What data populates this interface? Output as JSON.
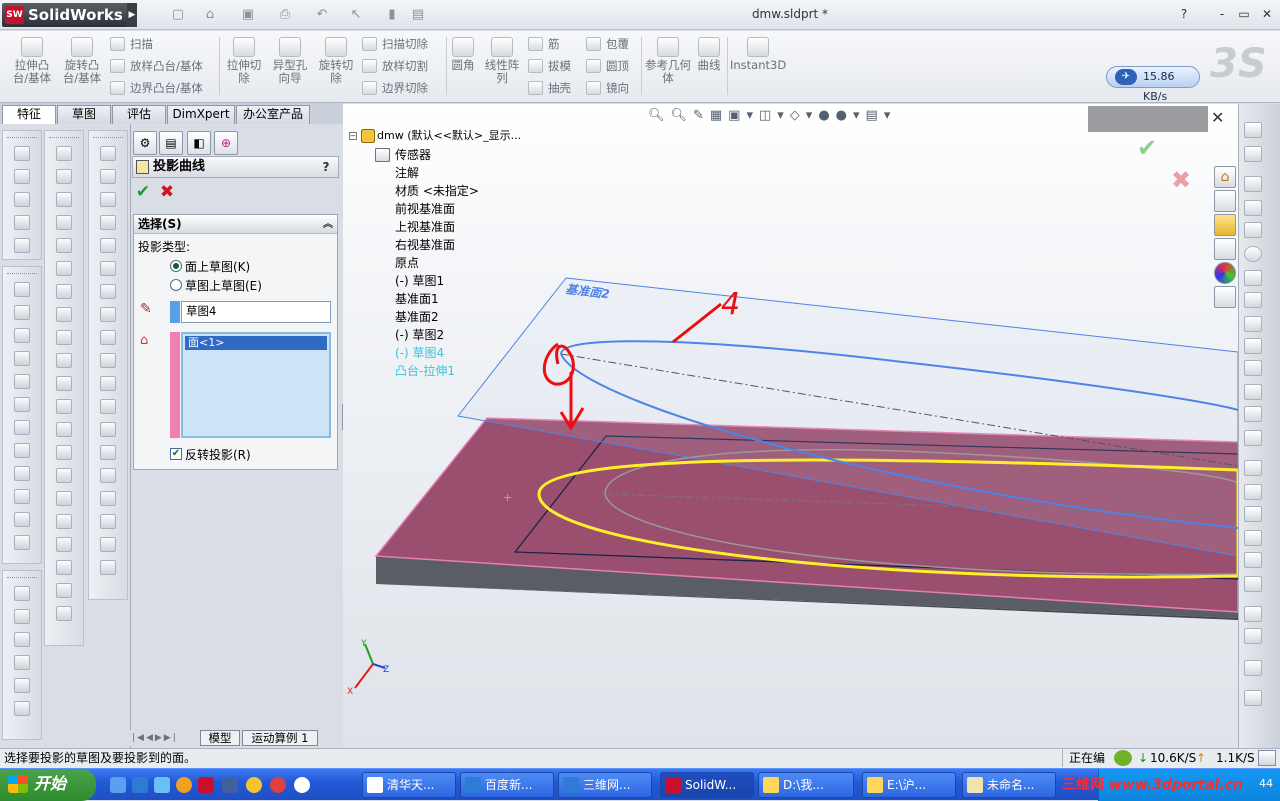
{
  "app": {
    "brand": "SolidWorks",
    "brand_icon_text": "SW",
    "document_title": "dmw.sldprt *",
    "window_controls": [
      "?",
      "-",
      "▭",
      "✕"
    ]
  },
  "command_manager": {
    "big_buttons": [
      "拉伸凸台/基体",
      "旋转凸台/基体",
      "拉伸切除",
      "异型孔向导",
      "旋转切除",
      "圆角",
      "线性阵列",
      "参考几何体",
      "曲线",
      "Instant3D"
    ],
    "sweep_group": [
      "扫描",
      "放样凸台/基体",
      "边界凸台/基体"
    ],
    "cut_group": [
      "扫描切除",
      "放样切割",
      "边界切除"
    ],
    "feature_group": [
      "筋",
      "拔模",
      "抽壳"
    ],
    "wrap_group": [
      "包覆",
      "圆顶",
      "镜向"
    ],
    "net_speed": "15.86 KB/s"
  },
  "tabs": [
    "特征",
    "草图",
    "评估",
    "DimXpert",
    "办公室产品"
  ],
  "property_manager": {
    "title": "投影曲线",
    "help": "?",
    "group_title": "选择(S)",
    "projection_type_label": "投影类型:",
    "option_sketch_on_face": "面上草图(K)",
    "option_sketch_on_sketch": "草图上草图(E)",
    "sketch_field": "草图4",
    "faces_list": [
      "面<1>"
    ],
    "reverse_label": "反转投影(R)",
    "reverse_checked": true
  },
  "bottom_tabs": [
    "模型",
    "运动算例 1"
  ],
  "feature_tree": {
    "root": "dmw   (默认<<默认>_显示...",
    "items": [
      {
        "label": "传感器",
        "highlight": false
      },
      {
        "label": "注解",
        "highlight": false
      },
      {
        "label": "材质 <未指定>",
        "highlight": false
      },
      {
        "label": "前视基准面",
        "highlight": false
      },
      {
        "label": "上视基准面",
        "highlight": false
      },
      {
        "label": "右视基准面",
        "highlight": false
      },
      {
        "label": "原点",
        "highlight": false
      },
      {
        "label": "(-) 草图1",
        "highlight": false
      },
      {
        "label": "基准面1",
        "highlight": false
      },
      {
        "label": "基准面2",
        "highlight": false
      },
      {
        "label": "(-) 草图2",
        "highlight": false
      },
      {
        "label": "(-) 草图4",
        "highlight": true
      },
      {
        "label": "凸台-拉伸1",
        "highlight": true
      }
    ]
  },
  "viewport": {
    "plane_label": "基准面2",
    "annotation_text": "4",
    "triad": {
      "x": "X",
      "y": "Y",
      "z": "Z"
    },
    "close": "✕"
  },
  "statusbar": {
    "message": "选择要投影的草图及要投影到的面。",
    "right_status": "正在编",
    "download": "10.6K/S",
    "upload": "1.1K/S"
  },
  "taskbar": {
    "start": "开始",
    "tasks": [
      "清华天...",
      "百度新...",
      "三维网...",
      "SolidW...",
      "D:\\我...",
      "E:\\沪...",
      "未命名..."
    ],
    "watermark_cn": "三维网",
    "watermark_url": "www.3dportal.cn",
    "clock": "44"
  },
  "colors": {
    "accent": "#316ac5",
    "plate_top": "#9a4f6e",
    "highlight_text": "#34c6e0",
    "ok": "#1d9e2e",
    "cancel": "#d4141c"
  }
}
